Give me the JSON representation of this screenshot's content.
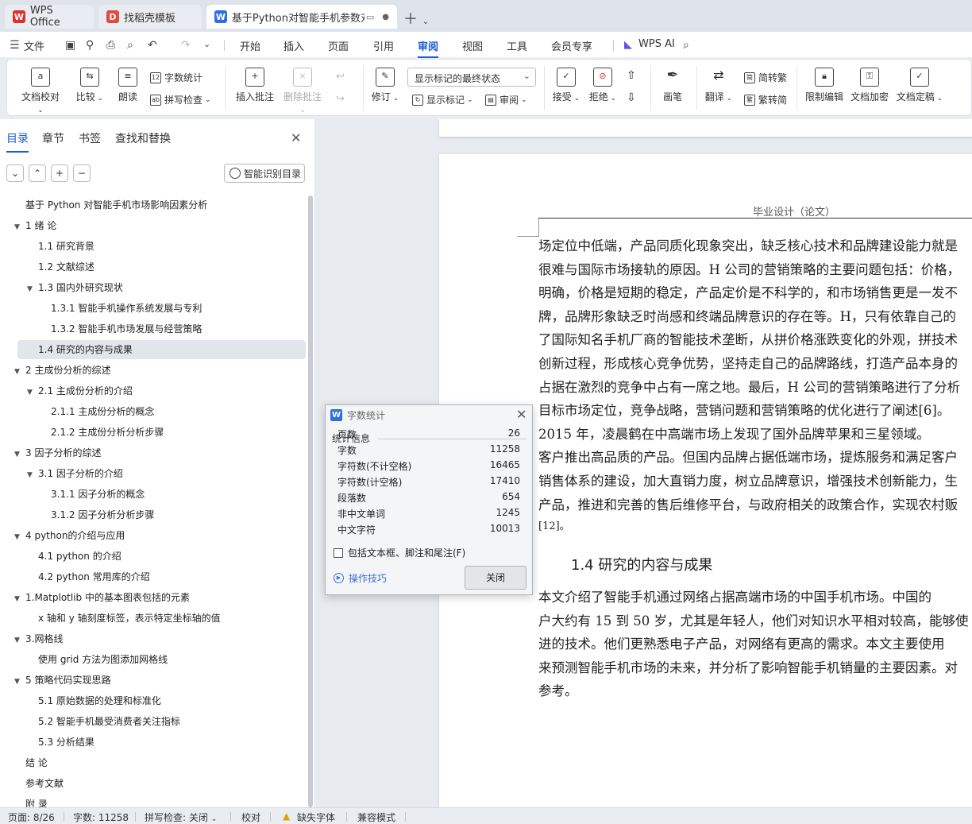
{
  "tabs": [
    {
      "label": "WPS Office",
      "logo": "W",
      "color": "#d9312b"
    },
    {
      "label": "找稻壳模板",
      "logo": "D",
      "color": "#e34a3b"
    },
    {
      "label": "基于Python对智能手机参数对",
      "logo": "W",
      "color": "#2f6fe4"
    }
  ],
  "menu": {
    "file": "文件",
    "items": [
      "开始",
      "插入",
      "页面",
      "引用",
      "审阅",
      "视图",
      "工具",
      "会员专享"
    ],
    "active": "审阅",
    "ai": "WPS AI"
  },
  "ribbon": {
    "doc_check": "文档校对",
    "compare": "比较",
    "read_aloud": "朗读",
    "word_count": "字数统计",
    "spell_check": "拼写检查",
    "insert_comment": "插入批注",
    "delete_comment": "删除批注",
    "track_changes": "修订",
    "markup_state": "显示标记的最终状态",
    "show_markup": "显示标记",
    "review": "审阅",
    "accept": "接受",
    "reject": "拒绝",
    "pen": "画笔",
    "translate": "翻译",
    "to_traditional": "简转繁",
    "to_simplified": "繁转简",
    "restrict_edit": "限制编辑",
    "encrypt": "文档加密",
    "finalize": "文档定稿"
  },
  "nav": {
    "tabs": [
      "目录",
      "章节",
      "书签",
      "查找和替换"
    ],
    "smart_toc": "智能识别目录",
    "toc": [
      {
        "label": "基于 Python 对智能手机市场影响因素分析",
        "level": 0,
        "arrow": false
      },
      {
        "label": "1 绪 论",
        "level": 0,
        "arrow": true
      },
      {
        "label": "1.1 研究背景",
        "level": 1,
        "arrow": false
      },
      {
        "label": "1.2 文献综述",
        "level": 1,
        "arrow": false
      },
      {
        "label": "1.3 国内外研究现状",
        "level": 1,
        "arrow": true
      },
      {
        "label": "1.3.1 智能手机操作系统发展与专利",
        "level": 2,
        "arrow": false
      },
      {
        "label": "1.3.2 智能手机市场发展与经营策略",
        "level": 2,
        "arrow": false
      },
      {
        "label": "1.4  研究的内容与成果",
        "level": 1,
        "arrow": false,
        "selected": true
      },
      {
        "label": "2 主成份分析的综述",
        "level": 0,
        "arrow": true
      },
      {
        "label": "2.1 主成份分析的介绍",
        "level": 1,
        "arrow": true
      },
      {
        "label": "2.1.1 主成份分析的概念",
        "level": 2,
        "arrow": false
      },
      {
        "label": "2.1.2 主成份分析分析步骤",
        "level": 2,
        "arrow": false
      },
      {
        "label": "3  因子分析的综述",
        "level": 0,
        "arrow": true
      },
      {
        "label": "3.1  因子分析的介绍",
        "level": 1,
        "arrow": true
      },
      {
        "label": "3.1.1  因子分析的概念",
        "level": 2,
        "arrow": false
      },
      {
        "label": "3.1.2 因子分析分析步骤",
        "level": 2,
        "arrow": false
      },
      {
        "label": "4 python的介绍与应用",
        "level": 0,
        "arrow": true
      },
      {
        "label": "4.1 python 的介绍",
        "level": 1,
        "arrow": false
      },
      {
        "label": "4.2 python 常用库的介绍",
        "level": 1,
        "arrow": false
      },
      {
        "label": "1.Matplotlib 中的基本图表包括的元素",
        "level": 0,
        "arrow": true
      },
      {
        "label": "x 轴和 y 轴刻度标签，表示特定坐标轴的值",
        "level": 1,
        "arrow": false
      },
      {
        "label": "3.网格线",
        "level": 0,
        "arrow": true
      },
      {
        "label": "使用 grid 方法为图添加网格线",
        "level": 1,
        "arrow": false
      },
      {
        "label": "5 策略代码实现思路",
        "level": 0,
        "arrow": true
      },
      {
        "label": "5.1  原始数据的处理和标准化",
        "level": 1,
        "arrow": false
      },
      {
        "label": "5.2  智能手机最受消费者关注指标",
        "level": 1,
        "arrow": false
      },
      {
        "label": "5.3  分析结果",
        "level": 1,
        "arrow": false
      },
      {
        "label": "结 论",
        "level": 0,
        "arrow": false
      },
      {
        "label": "参考文献",
        "level": 0,
        "arrow": false
      },
      {
        "label": "附 录",
        "level": 0,
        "arrow": false
      }
    ]
  },
  "document": {
    "header": "毕业设计（论文）",
    "lines": [
      "场定位中低端，产品同质化现象突出，缺乏核心技术和品牌建设能力就是",
      "很难与国际市场接轨的原因。H 公司的营销策略的主要问题包括：价格，",
      "明确，价格是短期的稳定，产品定价是不科学的，和市场销售更是一发不",
      "牌，品牌形象缺乏时尚感和终端品牌意识的存在等。H，只有依靠自己的",
      "了国际知名手机厂商的智能技术垄断，从拼价格涨跌变化的外观，拼技术",
      "创新过程，形成核心竞争优势，坚持走自己的品牌路线，打造产品本身的",
      "占据在激烈的竞争中占有一席之地。最后，H 公司的营销策略进行了分析",
      "目标市场定位，竞争战略，营销问题和营销策略的优化进行了阐述[6]。",
      "    2015 年，凌晨鹤在中高端市场上发现了国外品牌苹果和三星领域。",
      "客户推出高品质的产品。但国内品牌占据低端市场，提炼服务和满足客户",
      "销售体系的建设，加大直销力度，树立品牌意识，增强技术创新能力，生",
      "产品，推进和完善的售后维修平台，与政府相关的政策合作，实现农村贩",
      "[12]。"
    ],
    "heading": "1.4  研究的内容与成果",
    "lines2": [
      "    本文介绍了智能手机通过网络占据高端市场的中国手机市场。中国的",
      "户大约有 15 到 50 岁，尤其是年轻人，他们对知识水平相对较高，能够使",
      "进的技术。他们更熟悉电子产品，对网络有更高的需求。本文主要使用",
      "来预测智能手机市场的未来，并分析了影响智能手机销量的主要因素。对",
      "参考。"
    ]
  },
  "dialog": {
    "title": "字数统计",
    "section": "统计信息",
    "rows": [
      {
        "label": "页数",
        "value": "26"
      },
      {
        "label": "字数",
        "value": "11258"
      },
      {
        "label": "字符数(不计空格)",
        "value": "16465"
      },
      {
        "label": "字符数(计空格)",
        "value": "17410"
      },
      {
        "label": "段落数",
        "value": "654"
      },
      {
        "label": "非中文单词",
        "value": "1245"
      },
      {
        "label": "中文字符",
        "value": "10013"
      }
    ],
    "checkbox": "包括文本框、脚注和尾注(F)",
    "tips": "操作技巧",
    "close": "关闭"
  },
  "status": {
    "page": "页面: 8/26",
    "words": "字数: 11258",
    "spell": "拼写检查: 关闭",
    "proof": "校对",
    "missing_font": "缺失字体",
    "compat": "兼容模式"
  }
}
